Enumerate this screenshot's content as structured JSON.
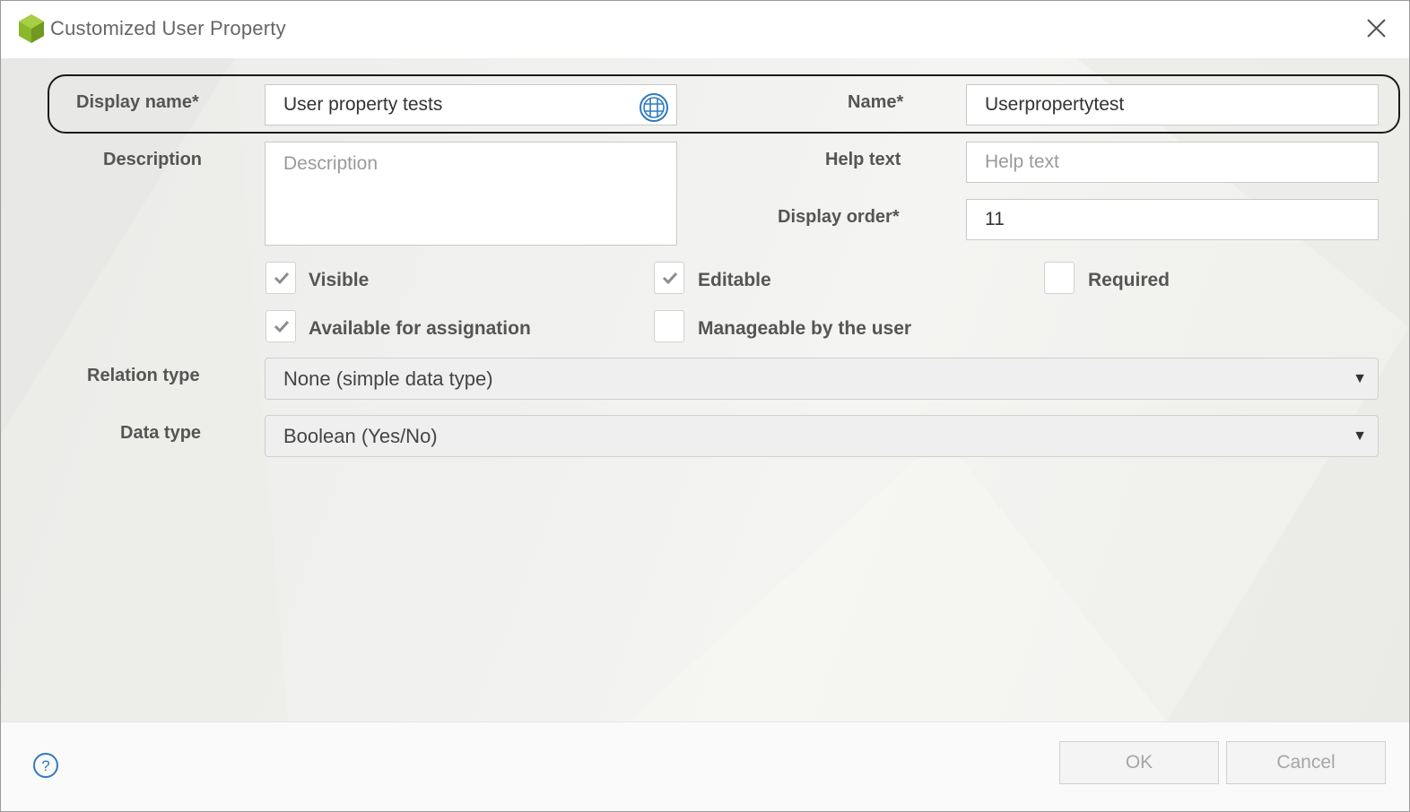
{
  "window": {
    "title": "Customized User Property"
  },
  "form": {
    "display_name": {
      "label": "Display name*",
      "value": "User property tests"
    },
    "name": {
      "label": "Name*",
      "value": "Userpropertytest"
    },
    "description": {
      "label": "Description",
      "value": "",
      "placeholder": "Description"
    },
    "help_text": {
      "label": "Help text",
      "value": "",
      "placeholder": "Help text"
    },
    "display_order": {
      "label": "Display order*",
      "value": "11"
    },
    "checkboxes": {
      "visible": {
        "label": "Visible",
        "checked": true
      },
      "editable": {
        "label": "Editable",
        "checked": true
      },
      "required": {
        "label": "Required",
        "checked": false
      },
      "available": {
        "label": "Available for assignation",
        "checked": true
      },
      "manageable": {
        "label": "Manageable by the user",
        "checked": false
      }
    },
    "relation_type": {
      "label": "Relation type",
      "value": "None (simple data type)"
    },
    "data_type": {
      "label": "Data type",
      "value": "Boolean (Yes/No)"
    }
  },
  "footer": {
    "ok_label": "OK",
    "cancel_label": "Cancel"
  },
  "icons": {
    "app": "app-cube-icon",
    "close": "close-icon",
    "translate": "globe-icon",
    "help": "help-icon",
    "dropdown": "chevron-down-icon",
    "check": "checkmark-icon"
  },
  "colors": {
    "accent": "#2f7ac0",
    "app_icon": "#8ab72b",
    "label": "#555555",
    "disabled_text": "#a6a6a6"
  }
}
